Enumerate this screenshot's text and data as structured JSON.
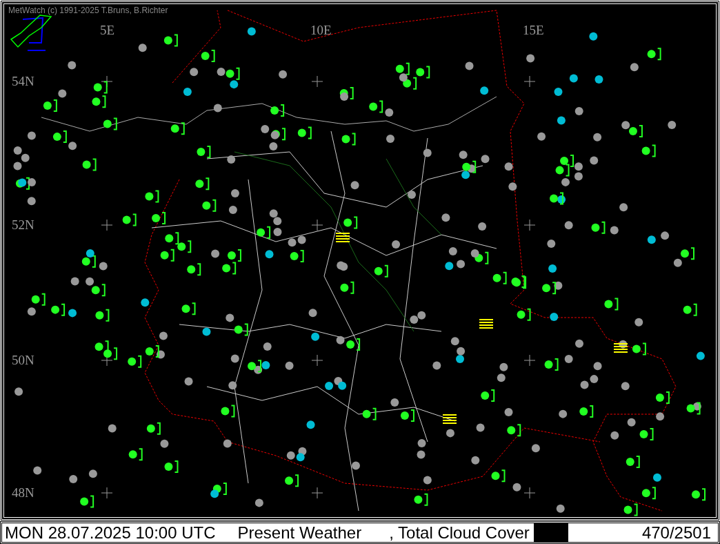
{
  "window": {
    "title": "MetWatch  (c) 1991-2025 T.Bruns, B.Richter"
  },
  "map": {
    "longitude_labels": [
      "5E",
      "10E",
      "15E"
    ],
    "latitude_labels": [
      "54N",
      "52N",
      "50N",
      "48N"
    ]
  },
  "status_bar": {
    "datetime": "MON 28.07.2025 10:00 UTC",
    "parameter": "Present Weather",
    "overlay": ", Total Cloud Cover",
    "count": "470/2501"
  }
}
